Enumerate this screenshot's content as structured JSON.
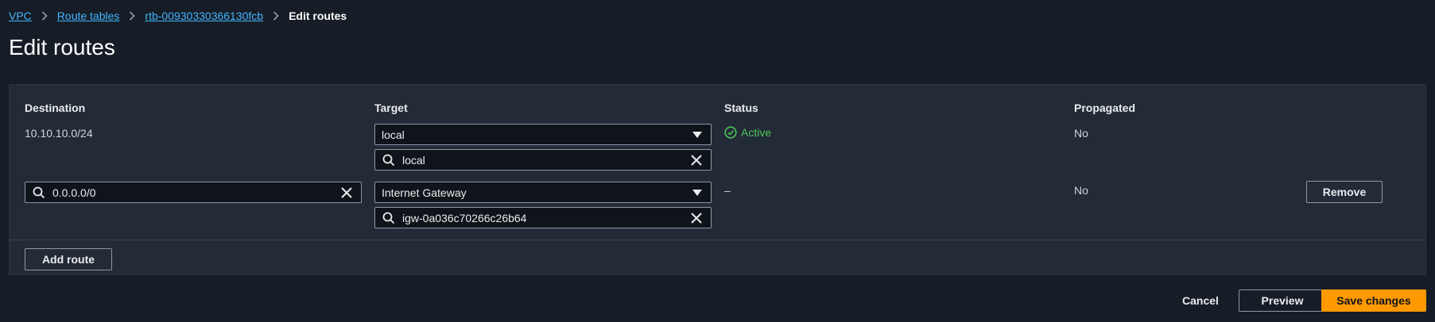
{
  "breadcrumb": {
    "items": [
      "VPC",
      "Route tables",
      "rtb-00930330366130fcb"
    ],
    "current": "Edit routes"
  },
  "page_title": "Edit routes",
  "table": {
    "columns": [
      "Destination",
      "Target",
      "Status",
      "Propagated"
    ],
    "rows": [
      {
        "destination": "10.10.10.0/24",
        "target_type": "local",
        "target_value": "local",
        "status": "Active",
        "propagated": "No"
      },
      {
        "destination": "0.0.0.0/0",
        "target_type": "Internet Gateway",
        "target_value": "igw-0a036c70266c26b64",
        "status": "–",
        "propagated": "No",
        "remove_label": "Remove"
      }
    ]
  },
  "add_route_label": "Add route",
  "footer": {
    "cancel_label": "Cancel",
    "preview_label": "Preview",
    "save_label": "Save changes"
  },
  "colors": {
    "background": "#161d26",
    "panel": "#232b37",
    "link": "#42b4ff",
    "primary": "#ff9900",
    "success": "#4cc25a"
  }
}
